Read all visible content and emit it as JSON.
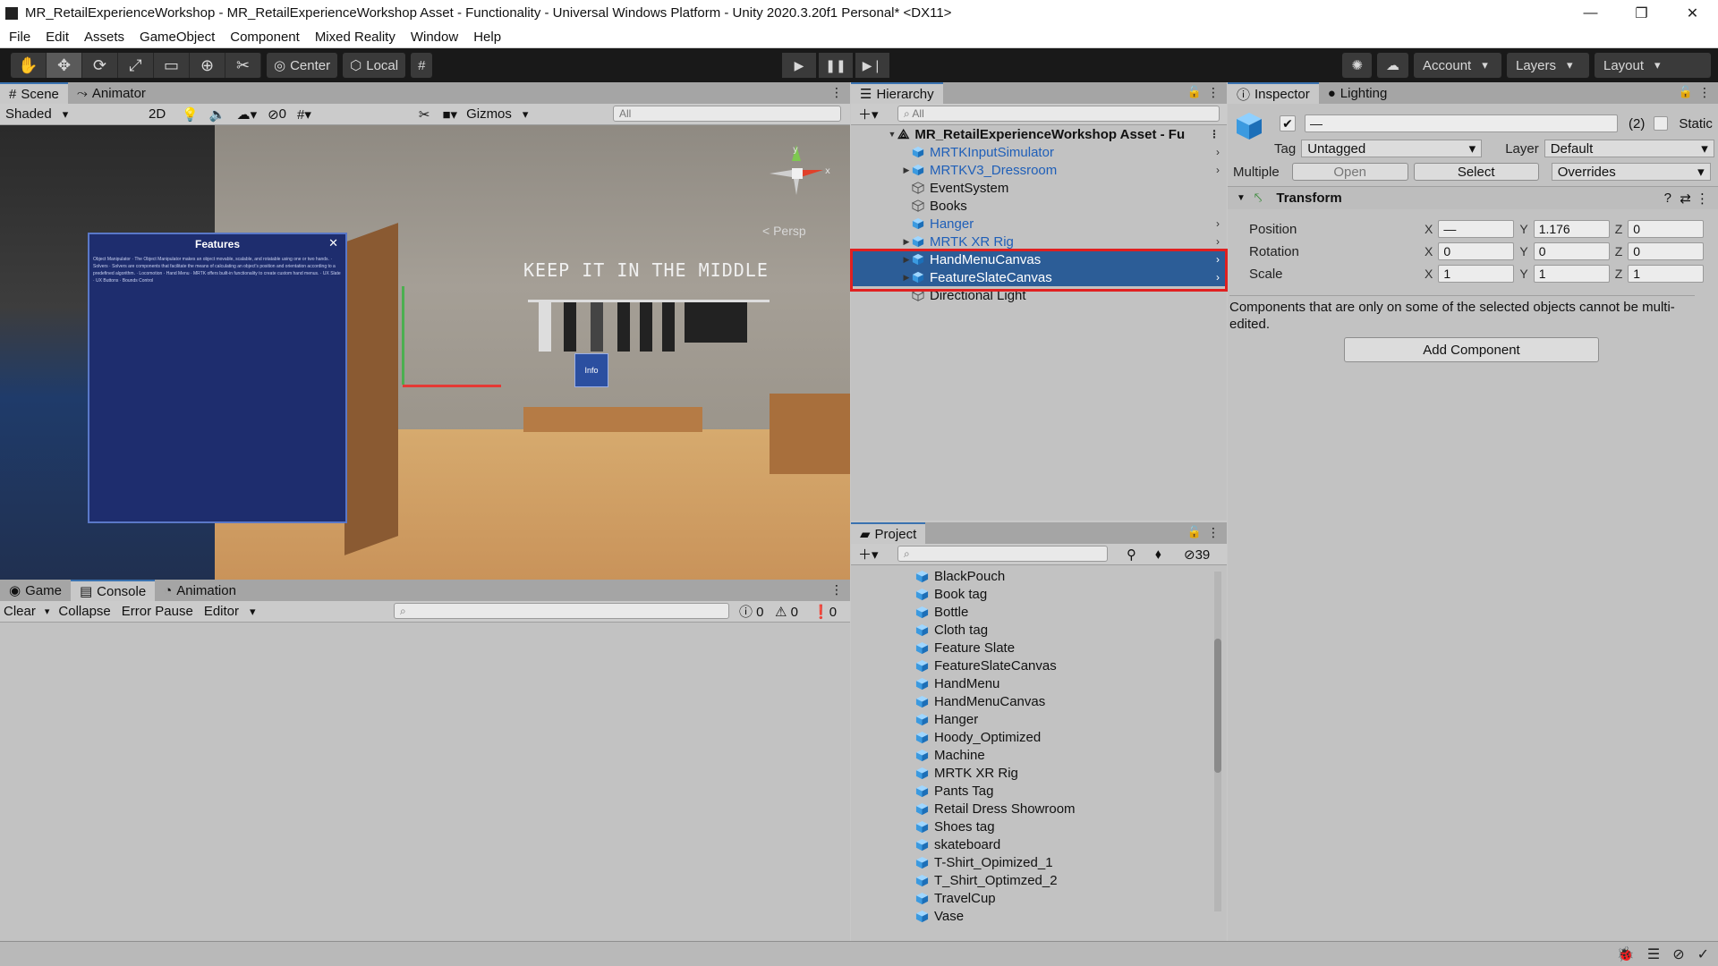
{
  "window": {
    "title": "MR_RetailExperienceWorkshop - MR_RetailExperienceWorkshop Asset - Functionality - Universal Windows Platform - Unity 2020.3.20f1 Personal* <DX11>",
    "minimize": "—",
    "restore": "❐",
    "close": "✕"
  },
  "menu": [
    "File",
    "Edit",
    "Assets",
    "GameObject",
    "Component",
    "Mixed Reality",
    "Window",
    "Help"
  ],
  "toolbar": {
    "pivot_label": "Center",
    "space_label": "Local",
    "account_label": "Account",
    "layers_label": "Layers",
    "layout_label": "Layout"
  },
  "scene": {
    "tabs": [
      "Scene",
      "Animator"
    ],
    "shading_mode": "Shaded",
    "mode_2d": "2D",
    "hidden_count": "0",
    "gizmos_label": "Gizmos",
    "search_placeholder": "All",
    "persp_label": "< Persp",
    "features_title": "Features",
    "features_body": "Object Manipulator · The Object Manipulator makes an object movable, scalable, and rotatable using one or two hands. · Solvers · Solvers are components that facilitate the means of calculating an object's position and orientation according to a predefined algorithm. · Locomotion · Hand Menu · MRTK offers built-in functionality to create custom hand menus. · UX Slate · UX Buttons · Bounds Control",
    "keep_text": "KEEP IT IN THE MIDDLE",
    "info_tag": "Info"
  },
  "console": {
    "tabs": [
      "Game",
      "Console",
      "Animation"
    ],
    "clear_label": "Clear",
    "collapse_label": "Collapse",
    "error_pause_label": "Error Pause",
    "editor_label": "Editor",
    "log_count": "0",
    "warn_count": "0",
    "error_count": "0"
  },
  "hierarchy": {
    "tab": "Hierarchy",
    "search_placeholder": "All",
    "root": "MR_RetailExperienceWorkshop Asset - Fu",
    "items": [
      {
        "label": "MRTKInputSimulator",
        "prefab": true,
        "expandable": false,
        "selected": false
      },
      {
        "label": "MRTKV3_Dressroom",
        "prefab": true,
        "expandable": true,
        "selected": false
      },
      {
        "label": "EventSystem",
        "prefab": false,
        "expandable": false,
        "selected": false
      },
      {
        "label": "Books",
        "prefab": false,
        "expandable": false,
        "selected": false
      },
      {
        "label": "Hanger",
        "prefab": true,
        "expandable": false,
        "selected": false
      },
      {
        "label": "MRTK XR Rig",
        "prefab": true,
        "expandable": true,
        "selected": false
      },
      {
        "label": "HandMenuCanvas",
        "prefab": true,
        "expandable": true,
        "selected": true
      },
      {
        "label": "FeatureSlateCanvas",
        "prefab": true,
        "expandable": true,
        "selected": true
      },
      {
        "label": "Directional Light",
        "prefab": false,
        "expandable": false,
        "selected": false
      }
    ]
  },
  "project": {
    "tab": "Project",
    "hidden_count": "39",
    "items": [
      "BlackPouch",
      "Book tag",
      "Bottle",
      "Cloth tag",
      "Feature Slate",
      "FeatureSlateCanvas",
      "HandMenu",
      "HandMenuCanvas",
      "Hanger",
      "Hoody_Optimized",
      "Machine",
      "MRTK XR Rig",
      "Pants Tag",
      "Retail Dress Showroom",
      "Shoes tag",
      "skateboard",
      "T-Shirt_Opimized_1",
      "T_Shirt_Optimzed_2",
      "TravelCup",
      "Vase"
    ]
  },
  "inspector": {
    "tabs": [
      "Inspector",
      "Lighting"
    ],
    "name_value": "—",
    "count": "(2)",
    "static_label": "Static",
    "tag_label": "Tag",
    "tag_value": "Untagged",
    "layer_label": "Layer",
    "layer_value": "Default",
    "multiple_label": "Multiple",
    "open_label": "Open",
    "select_label": "Select",
    "overrides_label": "Overrides",
    "transform_title": "Transform",
    "position_label": "Position",
    "rotation_label": "Rotation",
    "scale_label": "Scale",
    "position": {
      "x": "—",
      "y": "1.176",
      "z": "0"
    },
    "rotation": {
      "x": "0",
      "y": "0",
      "z": "0"
    },
    "scale": {
      "x": "1",
      "y": "1",
      "z": "1"
    },
    "multi_edit_note": "Components that are only on some of the selected objects cannot be multi-edited.",
    "add_component_label": "Add Component"
  },
  "colors": {
    "selection": "#2c5d97",
    "highlight_box": "#e02020",
    "prefab_text": "#1f5fb8",
    "toolbar_bg": "#191919"
  }
}
